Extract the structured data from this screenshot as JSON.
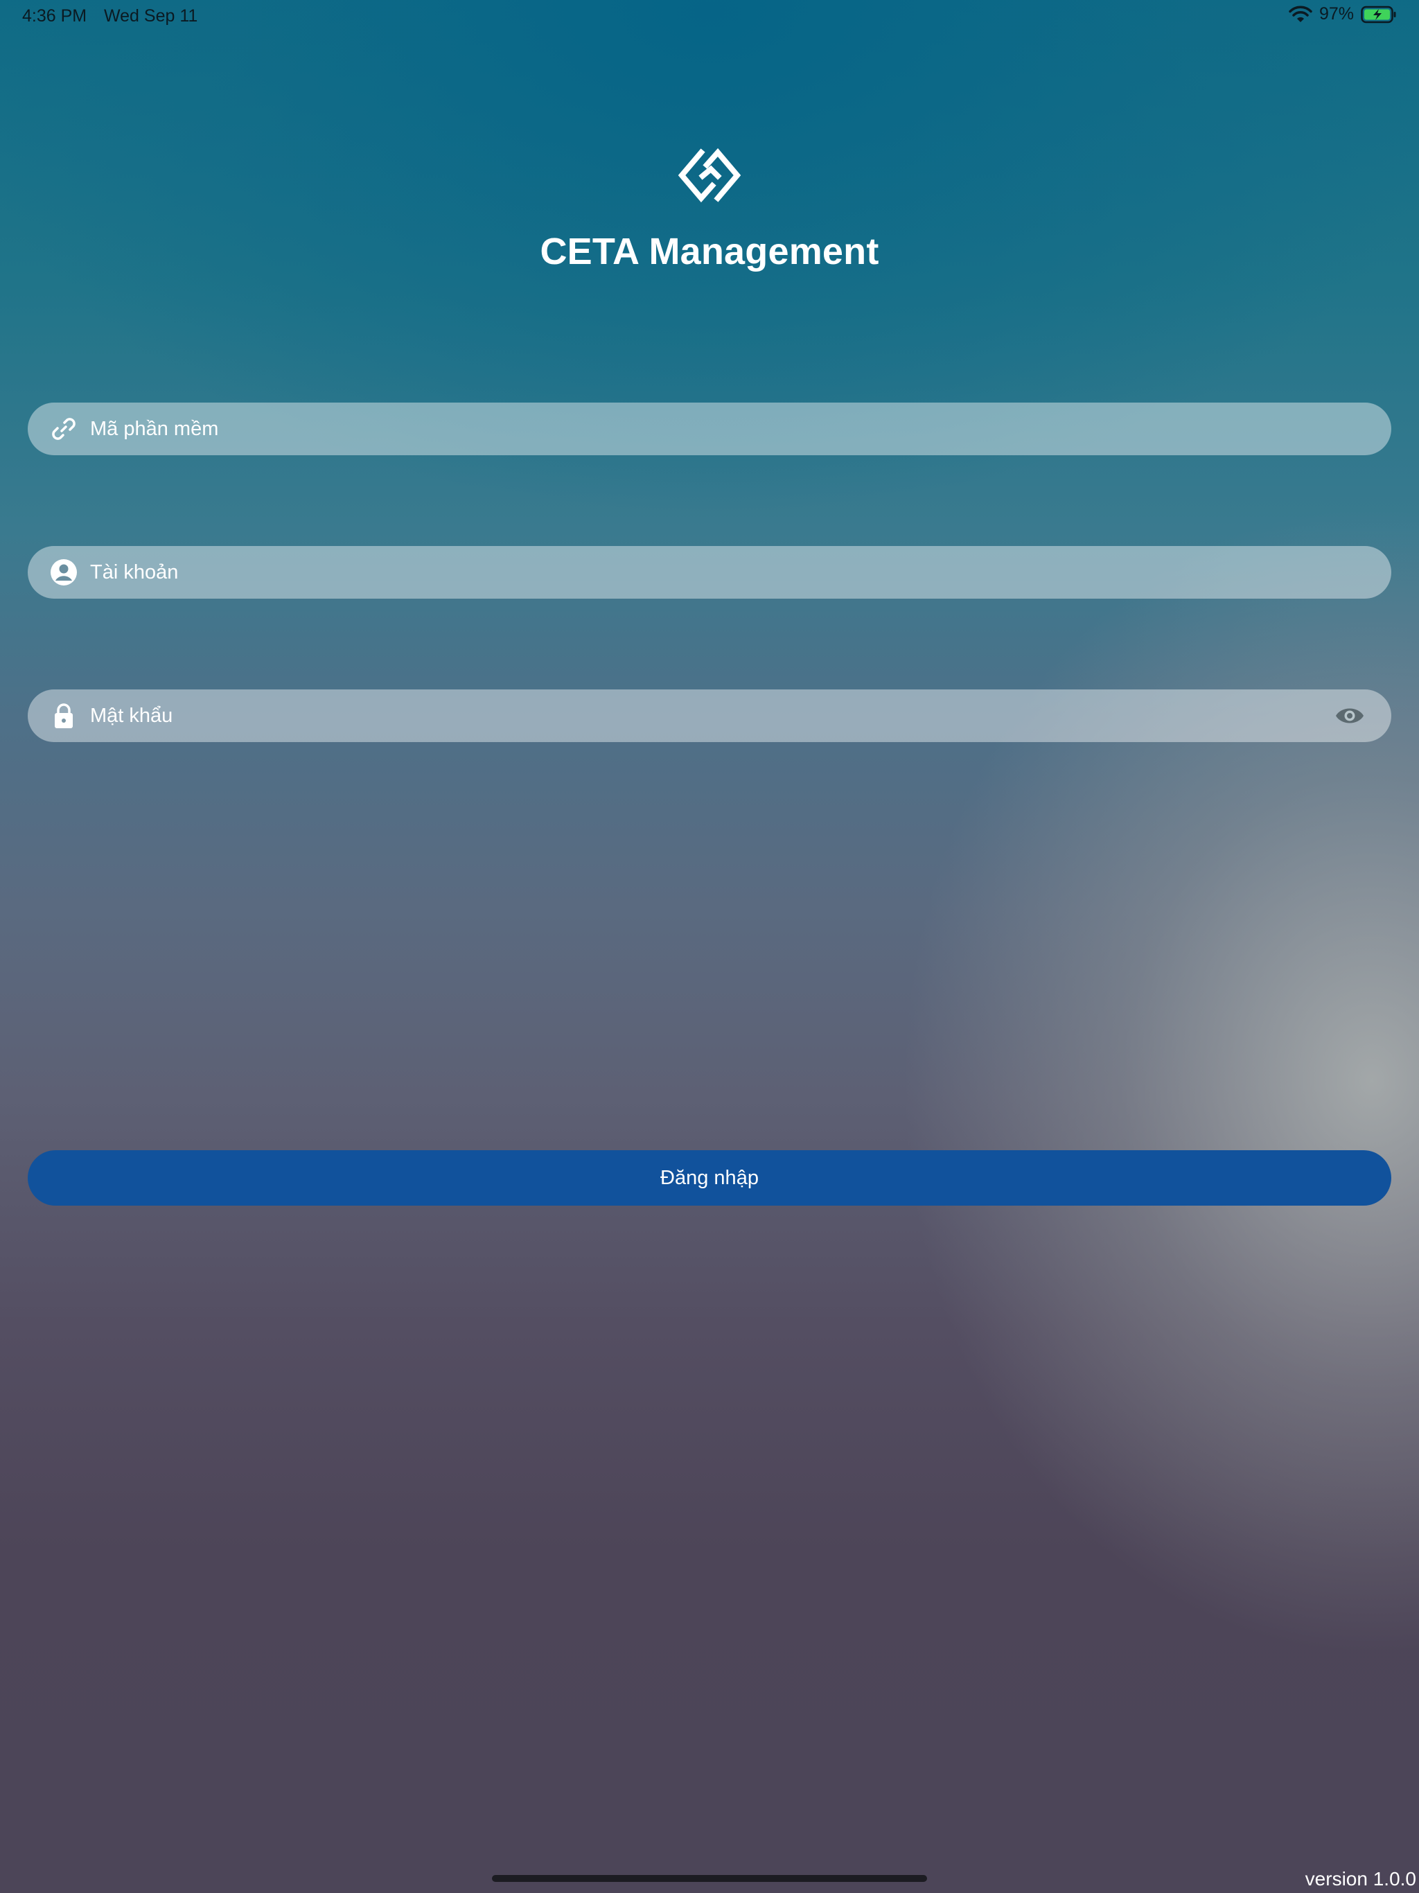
{
  "status_bar": {
    "time": "4:36 PM",
    "date": "Wed Sep 11",
    "battery_percent": "97%",
    "wifi_icon": "wifi-icon",
    "battery_icon": "battery-charging-icon"
  },
  "app": {
    "logo_icon": "ceta-logo-icon",
    "title": "CETA Management"
  },
  "form": {
    "software_code": {
      "icon": "link-icon",
      "placeholder": "Mã phần mềm",
      "value": ""
    },
    "account": {
      "icon": "user-circle-icon",
      "placeholder": "Tài khoản",
      "value": ""
    },
    "password": {
      "icon": "lock-icon",
      "placeholder": "Mật khẩu",
      "value": "",
      "toggle_icon": "eye-icon"
    },
    "login_label": "Đăng nhập"
  },
  "footer": {
    "version": "version 1.0.0"
  },
  "colors": {
    "primary_button": "#11529c",
    "field_background": "rgba(255,255,255,0.42)"
  }
}
